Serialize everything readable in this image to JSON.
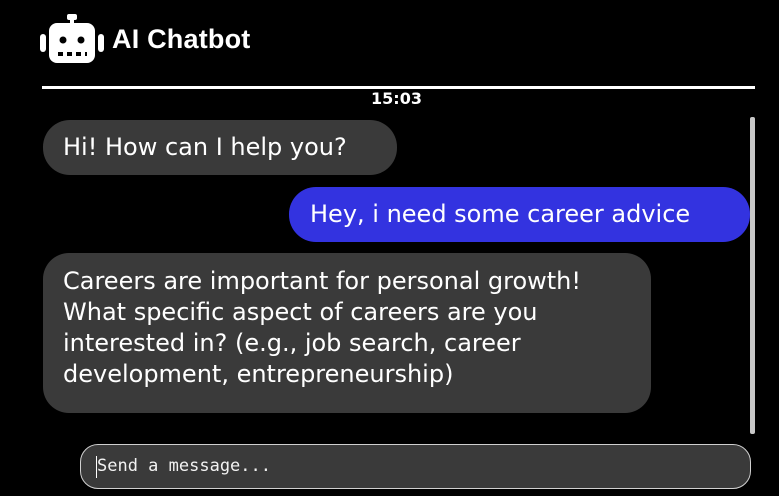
{
  "header": {
    "title": "AI Chatbot",
    "icon": "robot-icon"
  },
  "chat": {
    "timestamp": "15:03",
    "messages": [
      {
        "sender": "bot",
        "text": "Hi! How can I help you?"
      },
      {
        "sender": "user",
        "text": "Hey, i need some career advice"
      },
      {
        "sender": "bot",
        "text": "Careers are important for personal growth! What specific aspect of careers are you interested in? (e.g., job search, career development, entrepreneurship)"
      }
    ]
  },
  "composer": {
    "placeholder": "Send a message...",
    "value": ""
  },
  "colors": {
    "background": "#000000",
    "bot_bubble": "#3a3a3a",
    "user_bubble": "#3333e0",
    "text": "#ffffff"
  }
}
